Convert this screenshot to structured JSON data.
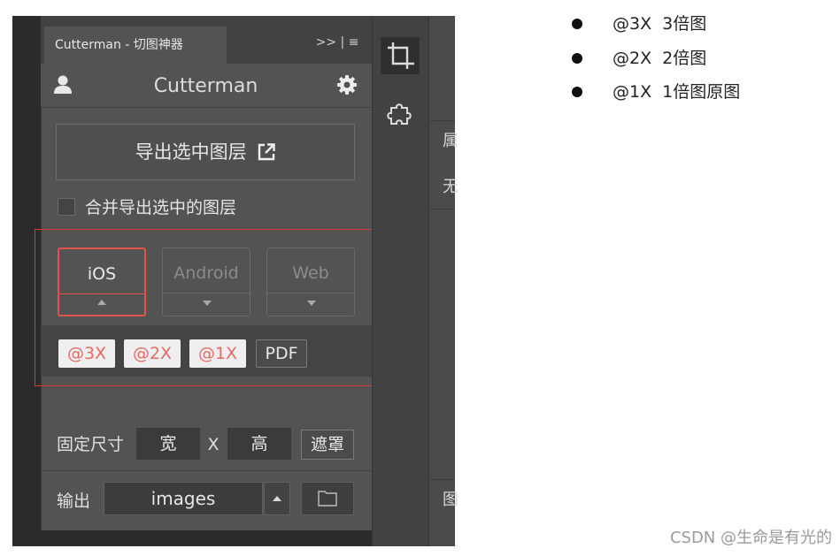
{
  "panel": {
    "tab_title": "Cutterman - 切图神器",
    "tab_menu": ">> | ≡",
    "app_title": "Cutterman",
    "export_button": "导出选中图层",
    "merge_label": "合并导出选中的图层",
    "platforms": [
      {
        "label": "iOS",
        "selected": true
      },
      {
        "label": "Android",
        "selected": false
      },
      {
        "label": "Web",
        "selected": false
      }
    ],
    "scales": [
      "@3X",
      "@2X",
      "@1X"
    ],
    "pdf_label": "PDF",
    "fixed_size": {
      "label": "固定尺寸",
      "width": "宽",
      "x": "X",
      "height": "高",
      "mask": "遮罩"
    },
    "output": {
      "label": "输出",
      "path": "images"
    },
    "icons": [
      "user-icon",
      "gear-icon",
      "external-link-icon",
      "crop-icon",
      "puzzle-icon",
      "folder-icon"
    ]
  },
  "right_panel": {
    "chars": [
      "属",
      "无",
      "图"
    ]
  },
  "notes": {
    "items": [
      "@3X  3倍图",
      "@2X  2倍图",
      "@1X  1倍图原图"
    ]
  },
  "watermark": "CSDN @生命是有光的",
  "colors": {
    "accent_red": "#e0383a",
    "panel_bg": "#535353",
    "scale_text": "#e56a63"
  }
}
